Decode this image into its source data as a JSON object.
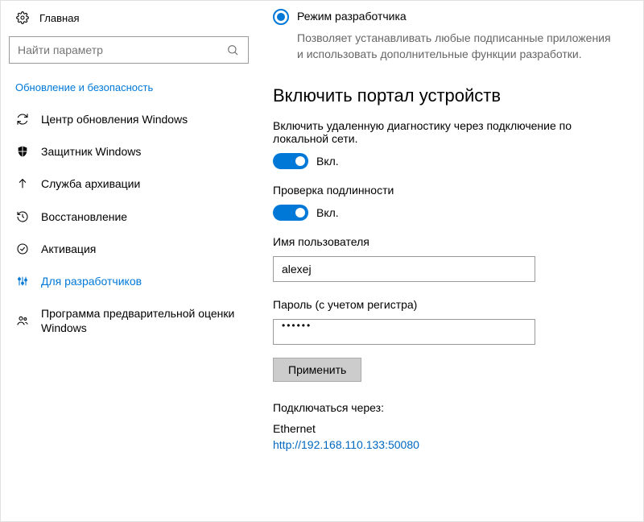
{
  "sidebar": {
    "home_label": "Главная",
    "search_placeholder": "Найти параметр",
    "section_title": "Обновление и безопасность",
    "items": [
      {
        "label": "Центр обновления Windows"
      },
      {
        "label": "Защитник Windows"
      },
      {
        "label": "Служба архивации"
      },
      {
        "label": "Восстановление"
      },
      {
        "label": "Активация"
      },
      {
        "label": "Для разработчиков"
      },
      {
        "label": "Программа предварительной оценки Windows"
      }
    ]
  },
  "radio": {
    "label": "Режим разработчика",
    "desc": "Позволяет устанавливать любые подписанные приложения и использовать дополнительные функции разработки."
  },
  "portal": {
    "title": "Включить портал устройств",
    "remote_desc": "Включить удаленную диагностику через подключение по локальной сети.",
    "toggle_on_label": "Вкл.",
    "auth_label": "Проверка подлинности",
    "username_label": "Имя пользователя",
    "username_value": "alexej",
    "password_label": "Пароль (с учетом регистра)",
    "password_display": "••••••",
    "apply_label": "Применить",
    "connect_label": "Подключаться через:",
    "connection_name": "Ethernet",
    "connection_url": "http://192.168.110.133:50080"
  }
}
